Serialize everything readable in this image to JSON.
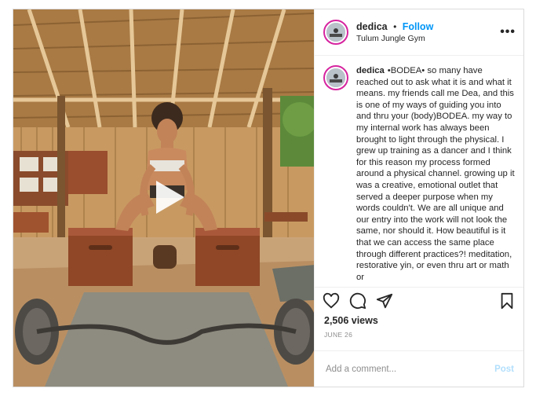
{
  "post": {
    "username": "dedica",
    "separator": "•",
    "follow_label": "Follow",
    "location": "Tulum Jungle Gym",
    "more_label": "•••",
    "caption_username": "dedica",
    "caption": "•BODEA• so many have reached out to ask what it is and what it means. my friends call me Dea, and this is one of my ways of guiding you into and thru your (body)BODEA. my way to my internal work has always been brought to light through the physical. I grew up training as a dancer and I think for this reason my process formed around a physical channel. growing up it was a creative, emotional outlet that served a deeper purpose when my words couldn't. We are all unique and our entry into the work will not look the same, nor should it. How beautiful is it that we can access the same place through different practices?! meditation, restorative yin, or even thru art or math or",
    "views": "2,506 views",
    "date": "JUNE 26",
    "comment_placeholder": "Add a comment...",
    "post_button": "Post"
  },
  "icons": {
    "like": "heart-icon",
    "comment": "comment-icon",
    "share": "paper-plane-icon",
    "save": "bookmark-icon",
    "play": "play-icon",
    "more": "ellipsis-icon"
  },
  "colors": {
    "link_blue": "#0095f6",
    "post_disabled": "#b2dffc",
    "story_ring": "#d6249f",
    "muted": "#8e8e8e"
  }
}
